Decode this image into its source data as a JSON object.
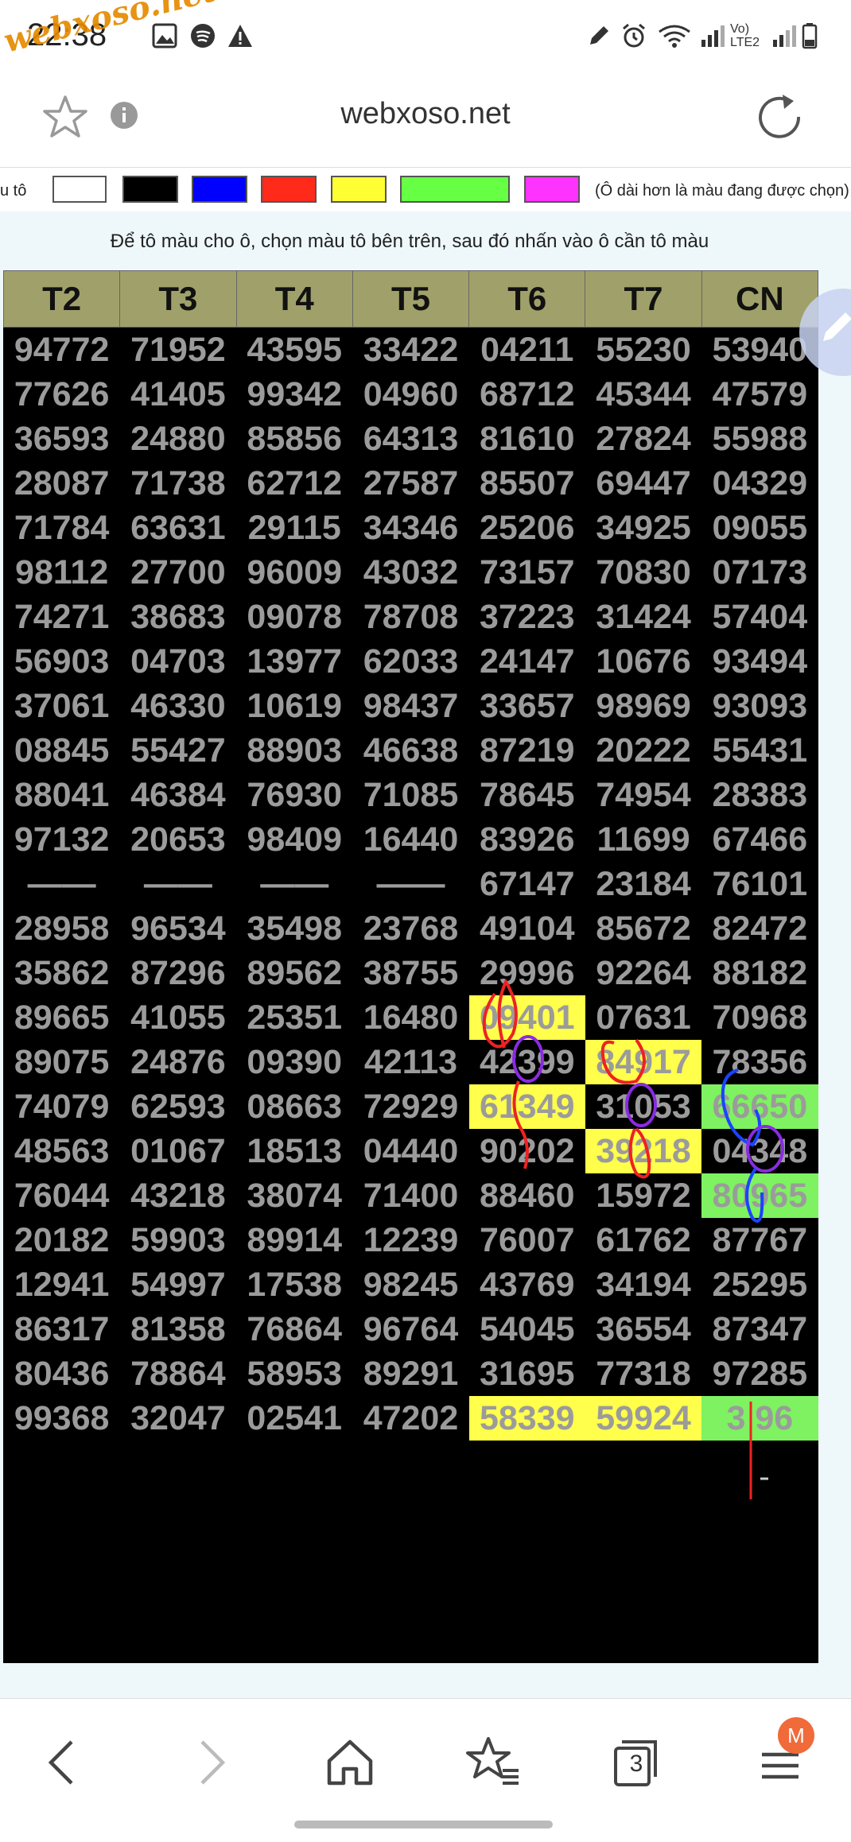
{
  "status_bar": {
    "time": "22:38",
    "watermark": "webxoso.net",
    "network_label": "Vo) LTE2"
  },
  "browser": {
    "site_title": "webxoso.net",
    "tab_count": "3",
    "avatar_letter": "M"
  },
  "color_picker": {
    "label": "u tô",
    "note": "(Ô dài hơn là màu đang được chọn)",
    "colors": [
      "#ffffff",
      "#000000",
      "#0000ff",
      "#ff2a1a",
      "#ffff33",
      "#66ff44",
      "#ff33ff"
    ]
  },
  "instruction": "Để tô màu cho ô, chọn màu tô bên trên, sau đó nhấn vào ô cần tô màu",
  "table": {
    "headers": [
      "T2",
      "T3",
      "T4",
      "T5",
      "T6",
      "T7",
      "CN"
    ],
    "rows": [
      [
        "94772",
        "71952",
        "43595",
        "33422",
        "04211",
        "55230",
        "53940"
      ],
      [
        "77626",
        "41405",
        "99342",
        "04960",
        "68712",
        "45344",
        "47579"
      ],
      [
        "36593",
        "24880",
        "85856",
        "64313",
        "81610",
        "27824",
        "55988"
      ],
      [
        "28087",
        "71738",
        "62712",
        "27587",
        "85507",
        "69447",
        "04329"
      ],
      [
        "71784",
        "63631",
        "29115",
        "34346",
        "25206",
        "34925",
        "09055"
      ],
      [
        "98112",
        "27700",
        "96009",
        "43032",
        "73157",
        "70830",
        "07173"
      ],
      [
        "74271",
        "38683",
        "09078",
        "78708",
        "37223",
        "31424",
        "57404"
      ],
      [
        "56903",
        "04703",
        "13977",
        "62033",
        "24147",
        "10676",
        "93494"
      ],
      [
        "37061",
        "46330",
        "10619",
        "98437",
        "33657",
        "98969",
        "93093"
      ],
      [
        "08845",
        "55427",
        "88903",
        "46638",
        "87219",
        "20222",
        "55431"
      ],
      [
        "88041",
        "46384",
        "76930",
        "71085",
        "78645",
        "74954",
        "28383"
      ],
      [
        "97132",
        "20653",
        "98409",
        "16440",
        "83926",
        "11699",
        "67466"
      ],
      [
        "——",
        "——",
        "——",
        "——",
        "67147",
        "23184",
        "76101"
      ],
      [
        "28958",
        "96534",
        "35498",
        "23768",
        "49104",
        "85672",
        "82472"
      ],
      [
        "35862",
        "87296",
        "89562",
        "38755",
        "29996",
        "92264",
        "88182"
      ],
      [
        "89665",
        "41055",
        "25351",
        "16480",
        "09401",
        "07631",
        "70968"
      ],
      [
        "89075",
        "24876",
        "09390",
        "42113",
        "42399",
        "84917",
        "78356"
      ],
      [
        "74079",
        "62593",
        "08663",
        "72929",
        "61349",
        "31053",
        "66650"
      ],
      [
        "48563",
        "01067",
        "18513",
        "04440",
        "90202",
        "39218",
        "04348"
      ],
      [
        "76044",
        "43218",
        "38074",
        "71400",
        "88460",
        "15972",
        "80965"
      ],
      [
        "20182",
        "59903",
        "89914",
        "12239",
        "76007",
        "61762",
        "87767"
      ],
      [
        "12941",
        "54997",
        "17538",
        "98245",
        "43769",
        "34194",
        "25295"
      ],
      [
        "86317",
        "81358",
        "76864",
        "96764",
        "54045",
        "36554",
        "87347"
      ],
      [
        "80436",
        "78864",
        "58953",
        "89291",
        "31695",
        "77318",
        "97285"
      ],
      [
        "99368",
        "32047",
        "02541",
        "47202",
        "58339",
        "59924",
        "3 96"
      ]
    ],
    "highlights": [
      {
        "row": 15,
        "col": 4,
        "color": "yellow"
      },
      {
        "row": 16,
        "col": 5,
        "color": "yellow"
      },
      {
        "row": 17,
        "col": 4,
        "color": "yellow"
      },
      {
        "row": 17,
        "col": 6,
        "color": "green"
      },
      {
        "row": 18,
        "col": 5,
        "color": "yellow"
      },
      {
        "row": 19,
        "col": 6,
        "color": "green"
      },
      {
        "row": 24,
        "col": 4,
        "color": "yellow"
      },
      {
        "row": 24,
        "col": 5,
        "color": "yellow"
      },
      {
        "row": 24,
        "col": 6,
        "color": "green"
      }
    ]
  }
}
